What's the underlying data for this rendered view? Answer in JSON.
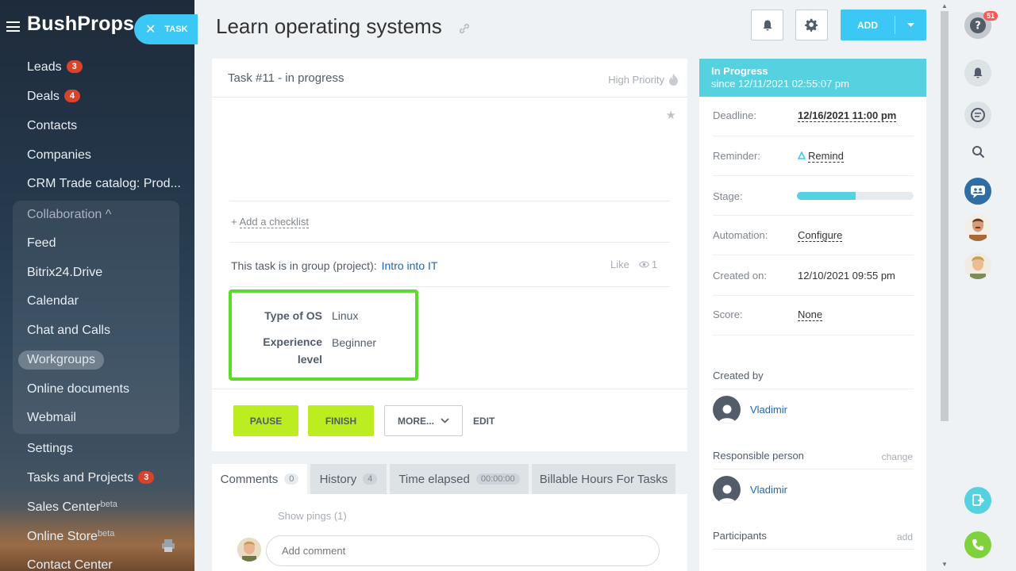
{
  "sidebar": {
    "logo": "BushProps",
    "task_button": "TASK",
    "items": [
      {
        "label": "Leads",
        "badge": "3"
      },
      {
        "label": "Deals",
        "badge": "4"
      },
      {
        "label": "Contacts"
      },
      {
        "label": "Companies"
      },
      {
        "label": "CRM Trade catalog: Prod..."
      },
      {
        "label": "Collaboration ^"
      },
      {
        "label": "Feed"
      },
      {
        "label": "Bitrix24.Drive"
      },
      {
        "label": "Calendar"
      },
      {
        "label": "Chat and Calls"
      },
      {
        "label": "Workgroups"
      },
      {
        "label": "Online documents"
      },
      {
        "label": "Webmail"
      },
      {
        "label": "Settings"
      },
      {
        "label": "Tasks and Projects",
        "badge": "3"
      },
      {
        "label": "Sales Center",
        "sup": "beta"
      },
      {
        "label": "Online Store",
        "sup": "beta"
      },
      {
        "label": "Contact Center"
      }
    ]
  },
  "header": {
    "title": "Learn operating systems",
    "add_label": "ADD"
  },
  "task": {
    "heading": "Task #11 - in progress",
    "priority": "High Priority",
    "checklist": "Add a checklist",
    "checklist_plus": "+",
    "group_text": "This task is in group (project):",
    "group_link": "Intro into IT",
    "like": "Like",
    "views": "1",
    "fields": [
      {
        "label": "Type of OS",
        "value": "Linux"
      },
      {
        "label": "Experience level",
        "value": "Beginner"
      }
    ],
    "buttons": {
      "pause": "PAUSE",
      "finish": "FINISH",
      "more": "MORE...",
      "edit": "EDIT"
    }
  },
  "tabs": [
    {
      "label": "Comments",
      "count": "0"
    },
    {
      "label": "History",
      "count": "4"
    },
    {
      "label": "Time elapsed",
      "count": "00:00:00"
    },
    {
      "label": "Billable Hours For Tasks"
    }
  ],
  "comments": {
    "show_pings": "Show pings (1)",
    "placeholder": "Add comment"
  },
  "details": {
    "status": "In Progress",
    "status_since": "since 12/11/2021 02:55:07 pm",
    "rows": [
      {
        "label": "Deadline:",
        "value": "12/16/2021 11:00 pm"
      },
      {
        "label": "Reminder:",
        "value": "Remind"
      },
      {
        "label": "Stage:",
        "value": ""
      },
      {
        "label": "Automation:",
        "value": "Configure"
      },
      {
        "label": "Created on:",
        "value": "12/10/2021 09:55 pm"
      },
      {
        "label": "Score:",
        "value": "None"
      }
    ],
    "stage_progress": 0.5,
    "created_by_label": "Created by",
    "created_by": "Vladimir",
    "responsible_label": "Responsible person",
    "responsible_action": "change",
    "responsible": "Vladimir",
    "participants_label": "Participants",
    "participants_action": "add"
  },
  "right_panel": {
    "notification_count": "51"
  },
  "colors": {
    "accent": "#3bc8f5",
    "status_header": "#56d1e0",
    "action_green": "#bbed21",
    "field_highlight": "#5ddb2a",
    "badge_red": "#d9432b"
  }
}
